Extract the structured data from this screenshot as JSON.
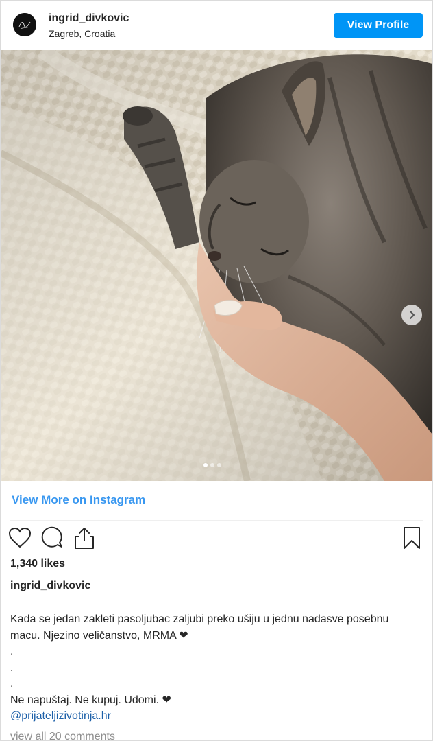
{
  "header": {
    "username": "ingrid_divkovic",
    "location": "Zagreb, Croatia",
    "view_profile_label": "View Profile"
  },
  "post": {
    "image_alt": "Cat sleeping on a cream blanket resting its head in a hand",
    "carousel_total": 3,
    "carousel_active": 1,
    "view_more_label": "View More on Instagram",
    "likes": "1,340 likes",
    "caption_username": "ingrid_divkovic",
    "caption_lines": [
      "Kada se jedan zakleti pasoljubac zaljubi preko ušiju u jednu nadasve posebnu macu. Njezino veličanstvo, MRMA ❤",
      ".",
      ".",
      ".",
      "Ne napuštaj. Ne kupuj. Udomi. ❤"
    ],
    "mention": "@prijateljizivotinja.hr",
    "view_all_comments": "view all 20 comments"
  },
  "colors": {
    "accent": "#0095f6",
    "link": "#3897f0",
    "border": "#dbdbdb"
  },
  "icons": [
    "heart-icon",
    "comment-icon",
    "share-icon",
    "bookmark-icon",
    "chevron-right-icon"
  ]
}
